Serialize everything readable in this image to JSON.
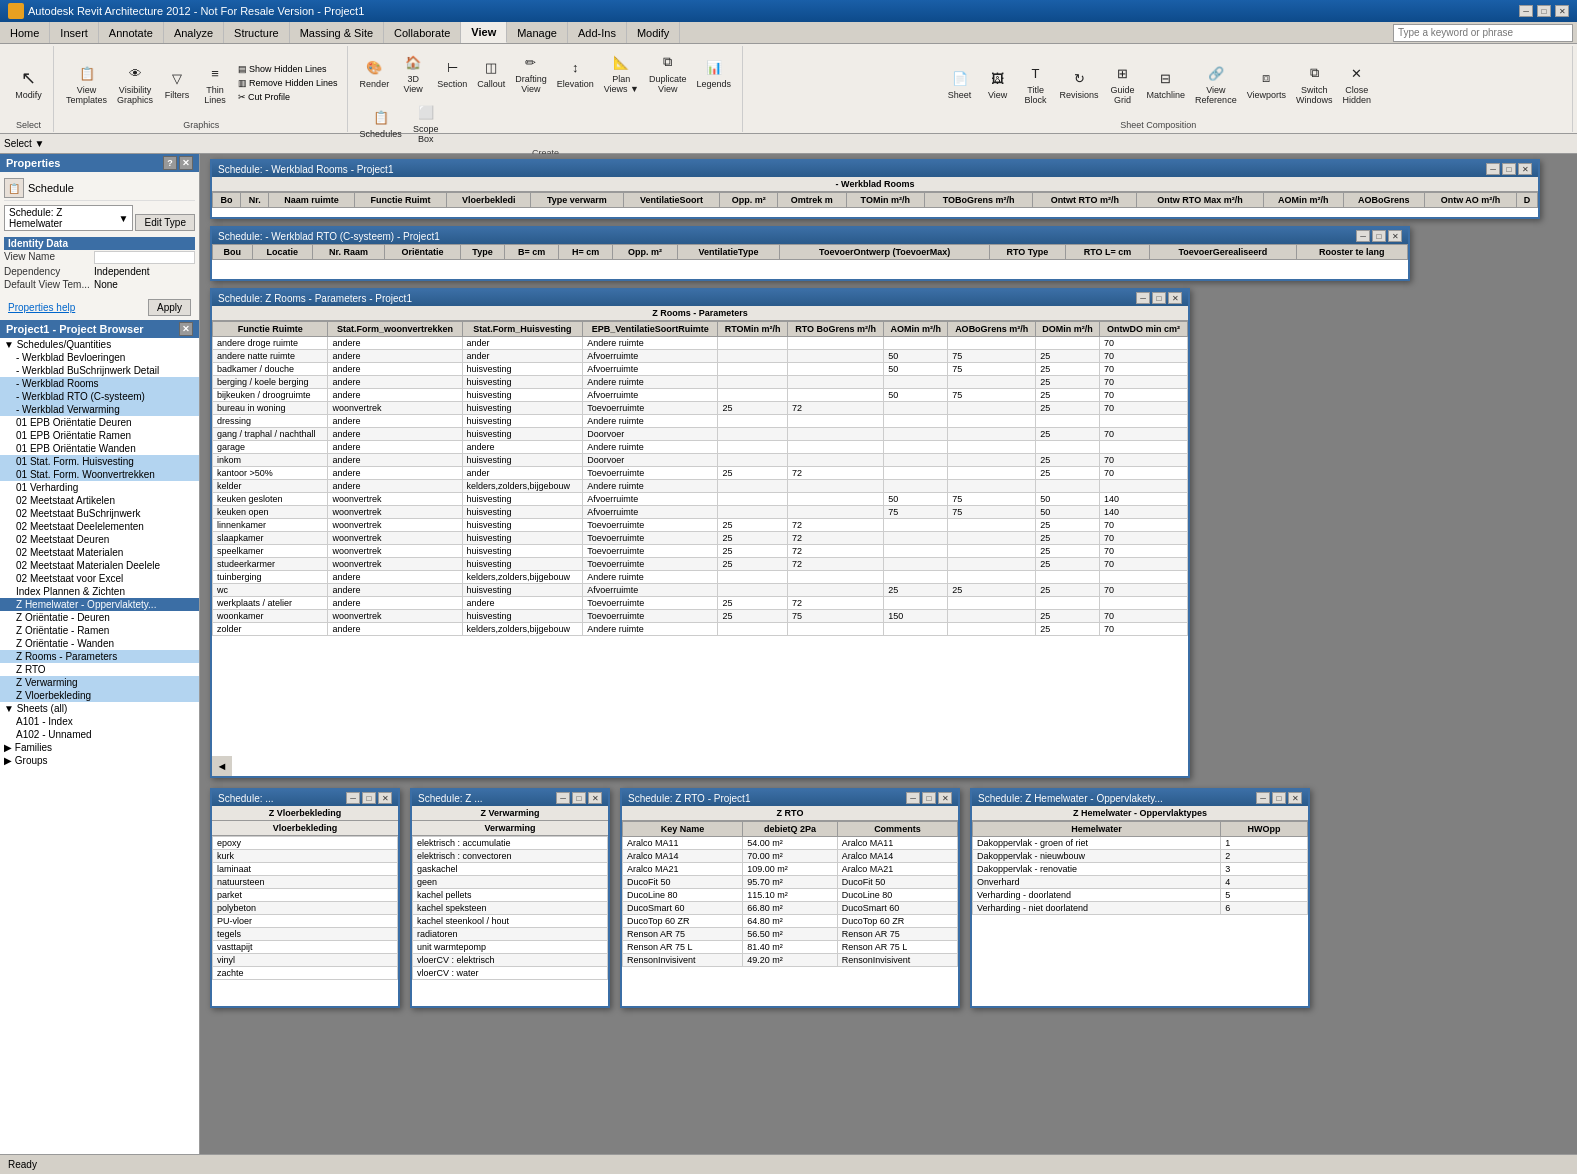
{
  "app": {
    "title": "Autodesk Revit Architecture 2012 - Not For Resale Version - Project1",
    "search_placeholder": "Type a keyword or phrase"
  },
  "ribbon": {
    "tabs": [
      "Home",
      "Insert",
      "Annotate",
      "Analyze",
      "Structure",
      "Massing & Site",
      "Collaborate",
      "View",
      "Manage",
      "Add-Ins",
      "Modify",
      ""
    ],
    "active_tab": "View",
    "groups": [
      {
        "name": "modify",
        "label": "Select",
        "buttons": [
          {
            "label": "Modify",
            "icon": "↖"
          }
        ]
      },
      {
        "name": "graphics",
        "label": "Graphics",
        "buttons": [
          {
            "label": "View\nTemplates",
            "icon": "📋"
          },
          {
            "label": "Visibility\nGraphics",
            "icon": "👁"
          },
          {
            "label": "Filters",
            "icon": "🔻"
          },
          {
            "label": "Thin\nLines",
            "icon": "≡"
          },
          {
            "label": "Show\nHidden Lines",
            "icon": ""
          },
          {
            "label": "Remove\nHidden Lines",
            "icon": ""
          }
        ]
      },
      {
        "name": "create",
        "label": "Create",
        "buttons": [
          {
            "label": "Cut\nProfile",
            "icon": ""
          },
          {
            "label": "Render",
            "icon": ""
          },
          {
            "label": "3D\nView",
            "icon": ""
          },
          {
            "label": "Section",
            "icon": ""
          },
          {
            "label": "Callout",
            "icon": ""
          },
          {
            "label": "Drafting\nView",
            "icon": ""
          },
          {
            "label": "Elevation",
            "icon": ""
          },
          {
            "label": "Plan\nViews",
            "icon": ""
          },
          {
            "label": "Duplicate\nView",
            "icon": ""
          },
          {
            "label": "Legends",
            "icon": ""
          },
          {
            "label": "Schedules",
            "icon": ""
          },
          {
            "label": "Scope\nBox",
            "icon": ""
          }
        ]
      },
      {
        "name": "sheet_composition",
        "label": "Sheet Composition",
        "buttons": [
          {
            "label": "Sheet",
            "icon": ""
          },
          {
            "label": "View",
            "icon": ""
          },
          {
            "label": "Title\nBlock",
            "icon": ""
          },
          {
            "label": "Revisions",
            "icon": ""
          },
          {
            "label": "Guide\nGrid",
            "icon": ""
          },
          {
            "label": "Matchline",
            "icon": ""
          },
          {
            "label": "View\nReference",
            "icon": ""
          },
          {
            "label": "Viewports",
            "icon": ""
          },
          {
            "label": "Switch\nWindows",
            "icon": ""
          },
          {
            "label": "Close\nHidden",
            "icon": ""
          }
        ]
      }
    ]
  },
  "properties": {
    "title": "Properties",
    "type": "Schedule",
    "schedule_name": "Schedule: Z Hemelwater",
    "identity_data": {
      "view_name": "",
      "dependency": "Independent",
      "default_view_template": "None"
    },
    "help_label": "Properties help",
    "apply_label": "Apply"
  },
  "project_browser": {
    "title": "Project1 - Project Browser",
    "items": [
      {
        "label": "Schedules/Quantities",
        "level": 1,
        "expanded": true,
        "type": "group"
      },
      {
        "label": "- Werkblad Bevloeringen",
        "level": 2,
        "selected": false
      },
      {
        "label": "- Werkblad BuSchrijnwerk Detail",
        "level": 2,
        "selected": false
      },
      {
        "label": "- Werkblad Rooms",
        "level": 2,
        "selected": true,
        "style": "selected-light"
      },
      {
        "label": "- Werkblad RTO (C-systeem)",
        "level": 2,
        "selected": true,
        "style": "selected-light"
      },
      {
        "label": "- Werkblad Verwarming",
        "level": 2,
        "selected": true,
        "style": "selected-light"
      },
      {
        "label": "01 EPB Oriëntatie Deuren",
        "level": 2,
        "selected": false
      },
      {
        "label": "01 EPB Oriëntatie Ramen",
        "level": 2,
        "selected": false
      },
      {
        "label": "01 EPB Oriëntatie Wanden",
        "level": 2,
        "selected": false
      },
      {
        "label": "01 Stat. Form. Huisvesting",
        "level": 2,
        "selected": true,
        "style": "selected-light"
      },
      {
        "label": "01 Stat. Form. Woonvertrekken",
        "level": 2,
        "selected": true,
        "style": "selected-light"
      },
      {
        "label": "01 Verharding",
        "level": 2,
        "selected": false
      },
      {
        "label": "02 Meetstaat Artikelen",
        "level": 2,
        "selected": false
      },
      {
        "label": "02 Meetstaat BuSchrijnwerk",
        "level": 2,
        "selected": false
      },
      {
        "label": "02 Meetstaat Deelelementen",
        "level": 2,
        "selected": false
      },
      {
        "label": "02 Meetstaat Deuren",
        "level": 2,
        "selected": false
      },
      {
        "label": "02 Meetstaat Materialen",
        "level": 2,
        "selected": false
      },
      {
        "label": "02 Meetstaat Materialen Deelele",
        "level": 2,
        "selected": false
      },
      {
        "label": "02 Meetstaat voor Excel",
        "level": 2,
        "selected": false
      },
      {
        "label": "Index Plannen & Zichten",
        "level": 2,
        "selected": false
      },
      {
        "label": "Z Hemelwater - Oppervlaktety...",
        "level": 2,
        "selected": true,
        "style": "selected"
      },
      {
        "label": "Z Oriëntatie - Deuren",
        "level": 2,
        "selected": false
      },
      {
        "label": "Z Oriëntatie - Ramen",
        "level": 2,
        "selected": false
      },
      {
        "label": "Z Oriëntatie - Wanden",
        "level": 2,
        "selected": false
      },
      {
        "label": "Z Rooms - Parameters",
        "level": 2,
        "selected": true,
        "style": "selected-light"
      },
      {
        "label": "Z RTO",
        "level": 2,
        "selected": false
      },
      {
        "label": "Z Verwarming",
        "level": 2,
        "selected": true,
        "style": "selected-light"
      },
      {
        "label": "Z Vloerbekleding",
        "level": 2,
        "selected": true,
        "style": "selected-light"
      },
      {
        "label": "Sheets (all)",
        "level": 1,
        "expanded": true,
        "type": "group"
      },
      {
        "label": "A101 - Index",
        "level": 2,
        "selected": false
      },
      {
        "label": "A102 - Unnamed",
        "level": 2,
        "selected": false
      },
      {
        "label": "Families",
        "level": 1,
        "type": "group"
      },
      {
        "label": "Groups",
        "level": 1,
        "type": "group"
      }
    ]
  },
  "schedule_rooms": {
    "title": "Schedule: - Werkblad Rooms - Project1",
    "headers": [
      "Bo",
      "Nr.",
      "Naam ruimte",
      "Functie Ruimt",
      "Vloerbekledi",
      "Type verwarm",
      "VentilatieSoort",
      "Opp. m²",
      "Omtrek m",
      "TOMin m²/h",
      "TOBoGrens m²/h",
      "Ontwt RTO m²/h",
      "Ontw RTO Max m²/h",
      "AOMin m²/h",
      "AOBoGrens",
      "Ontw AO m²/h",
      "D"
    ],
    "group_header": "- Werkblad Rooms"
  },
  "schedule_rto": {
    "title": "Schedule: - Werkblad RTO (C-systeem) - Project1",
    "headers": [
      "Bou",
      "Locatie",
      "Nr. Raam",
      "Oriëntatie",
      "Type",
      "B= cm",
      "H= cm",
      "Opp. m²",
      "VentilatieType",
      "ToevoerOntwerp (ToevoerMax)",
      "RTO Type",
      "RTO L= cm",
      "ToevoerGerealiseerd",
      "Rooster te lang"
    ]
  },
  "schedule_z_rooms": {
    "title": "Schedule: Z Rooms - Parameters - Project1",
    "group_header": "Z Rooms - Parameters",
    "headers": [
      "Functie Ruimte",
      "Stat.Form_woonvertrekken",
      "Stat.Form_Huisvesting",
      "EPB_VentilatieSoortRuimte",
      "RTOMin m²/h",
      "RTO BoGrens m²/h",
      "AOMin m²/h",
      "AOBoGrens m²/h",
      "DOMin m²/h",
      "OntwDO min cm²"
    ],
    "rows": [
      [
        "andere droge ruimte",
        "andere",
        "ander",
        "Andere ruimte",
        "",
        "",
        "",
        "",
        "",
        "70"
      ],
      [
        "andere natte ruimte",
        "andere",
        "ander",
        "Afvoerruimte",
        "",
        "",
        "50",
        "75",
        "25",
        "70"
      ],
      [
        "badkamer / douche",
        "andere",
        "huisvesting",
        "Afvoerruimte",
        "",
        "",
        "50",
        "75",
        "25",
        "70"
      ],
      [
        "berging / koele berging",
        "andere",
        "huisvesting",
        "Andere ruimte",
        "",
        "",
        "",
        "",
        "25",
        "70"
      ],
      [
        "bijkeuken / droogruimte",
        "andere",
        "huisvesting",
        "Afvoerruimte",
        "",
        "",
        "50",
        "75",
        "25",
        "70"
      ],
      [
        "bureau in woning",
        "woonvertrek",
        "huisvesting",
        "Toevoerruimte",
        "25",
        "72",
        "",
        "",
        "25",
        "70"
      ],
      [
        "dressing",
        "andere",
        "huisvesting",
        "Andere ruimte",
        "",
        "",
        "",
        "",
        "",
        ""
      ],
      [
        "gang / traphal / nachthall",
        "andere",
        "huisvesting",
        "Doorvoer",
        "",
        "",
        "",
        "",
        "25",
        "70"
      ],
      [
        "garage",
        "andere",
        "andere",
        "Andere ruimte",
        "",
        "",
        "",
        "",
        "",
        ""
      ],
      [
        "inkom",
        "andere",
        "huisvesting",
        "Doorvoer",
        "",
        "",
        "",
        "",
        "25",
        "70"
      ],
      [
        "kantoor >50%",
        "andere",
        "ander",
        "Toevoerruimte",
        "25",
        "72",
        "",
        "",
        "25",
        "70"
      ],
      [
        "kelder",
        "andere",
        "kelders,zolders,bijgebouw",
        "Andere ruimte",
        "",
        "",
        "",
        "",
        "",
        ""
      ],
      [
        "keuken gesloten",
        "woonvertrek",
        "huisvesting",
        "Afvoerruimte",
        "",
        "",
        "50",
        "75",
        "50",
        "140"
      ],
      [
        "keuken open",
        "woonvertrek",
        "huisvesting",
        "Afvoerruimte",
        "",
        "",
        "75",
        "75",
        "50",
        "140"
      ],
      [
        "linnenkamer",
        "woonvertrek",
        "huisvesting",
        "Toevoerruimte",
        "25",
        "72",
        "",
        "",
        "25",
        "70"
      ],
      [
        "slaapkamer",
        "woonvertrek",
        "huisvesting",
        "Toevoerruimte",
        "25",
        "72",
        "",
        "",
        "25",
        "70"
      ],
      [
        "speelkamer",
        "woonvertrek",
        "huisvesting",
        "Toevoerruimte",
        "25",
        "72",
        "",
        "",
        "25",
        "70"
      ],
      [
        "studeerkarmer",
        "woonvertrek",
        "huisvesting",
        "Toevoerruimte",
        "25",
        "72",
        "",
        "",
        "25",
        "70"
      ],
      [
        "tuinberging",
        "andere",
        "kelders,zolders,bijgebouw",
        "Andere ruimte",
        "",
        "",
        "",
        "",
        "",
        ""
      ],
      [
        "wc",
        "andere",
        "huisvesting",
        "Afvoerruimte",
        "",
        "",
        "25",
        "25",
        "25",
        "70"
      ],
      [
        "werkplaats / atelier",
        "andere",
        "andere",
        "Toevoerruimte",
        "25",
        "72",
        "",
        "",
        "",
        ""
      ],
      [
        "woonkamer",
        "woonvertrek",
        "huisvesting",
        "Toevoerruimte",
        "25",
        "75",
        "150",
        "",
        "25",
        "70"
      ],
      [
        "zolder",
        "andere",
        "kelders,zolders,bijgebouw",
        "Andere ruimte",
        "",
        "",
        "",
        "",
        "25",
        "70"
      ]
    ]
  },
  "schedule_vloerbekleding": {
    "title": "Schedule: ...",
    "group_header": "Z Vloerbekleding",
    "sub_header": "Vloerbekleding",
    "rows": [
      "epoxy",
      "kurk",
      "laminaat",
      "natuursteen",
      "parket",
      "polybeton",
      "PU-vloer",
      "tegels",
      "vasttapijt",
      "vinyl",
      "zachte"
    ]
  },
  "schedule_verwarming": {
    "title": "Schedule: Z ...",
    "group_header": "Z Verwarming",
    "sub_header": "Verwarming",
    "rows": [
      "elektrisch : accumulatie",
      "elektrisch : convectoren",
      "gaskachel",
      "geen",
      "kachel pellets",
      "kachel speksteen",
      "kachel steenkool / hout",
      "radiatoren",
      "unit warmtepomp",
      "vloerCV : elektrisch",
      "vloerCV : water"
    ]
  },
  "schedule_z_rto": {
    "title": "Schedule: Z RTO - Project1",
    "group_header": "Z RTO",
    "headers": [
      "Key Name",
      "debietQ 2Pa",
      "Comments"
    ],
    "rows": [
      [
        "Aralco MA11",
        "54.00 m²",
        "Aralco MA11"
      ],
      [
        "Aralco MA14",
        "70.00 m²",
        "Aralco MA14"
      ],
      [
        "Aralco MA21",
        "109.00 m²",
        "Aralco MA21"
      ],
      [
        "DucoFit 50",
        "95.70 m²",
        "DucoFit 50"
      ],
      [
        "DucoLine 80",
        "115.10 m²",
        "DucoLine 80"
      ],
      [
        "DucoSmart 60",
        "66.80 m²",
        "DucoSmart 60"
      ],
      [
        "DucoTop 60 ZR",
        "64.80 m²",
        "DucoTop 60 ZR"
      ],
      [
        "Renson AR 75",
        "56.50 m²",
        "Renson AR 75"
      ],
      [
        "Renson AR 75 L",
        "81.40 m²",
        "Renson AR 75 L"
      ],
      [
        "RensonInvisivent",
        "49.20 m²",
        "RensonInvisivent"
      ]
    ]
  },
  "schedule_hemelwater": {
    "title": "Schedule: Z Hemelwater - Oppervlakety...",
    "group_header": "Z Hemelwater - Oppervlaktypes",
    "headers": [
      "Hemelwater",
      "HWOpp"
    ],
    "rows": [
      [
        "Dakoppervlak - groen of riet",
        "1"
      ],
      [
        "Dakoppervlak - nieuwbouw",
        "2"
      ],
      [
        "Dakoppervlak - renovatie",
        "3"
      ],
      [
        "Onverhard",
        "4"
      ],
      [
        "Verharding - doorlatend",
        "5"
      ],
      [
        "Verharding - niet doorlatend",
        "6"
      ]
    ]
  },
  "status_bar": {
    "text": "Ready"
  }
}
